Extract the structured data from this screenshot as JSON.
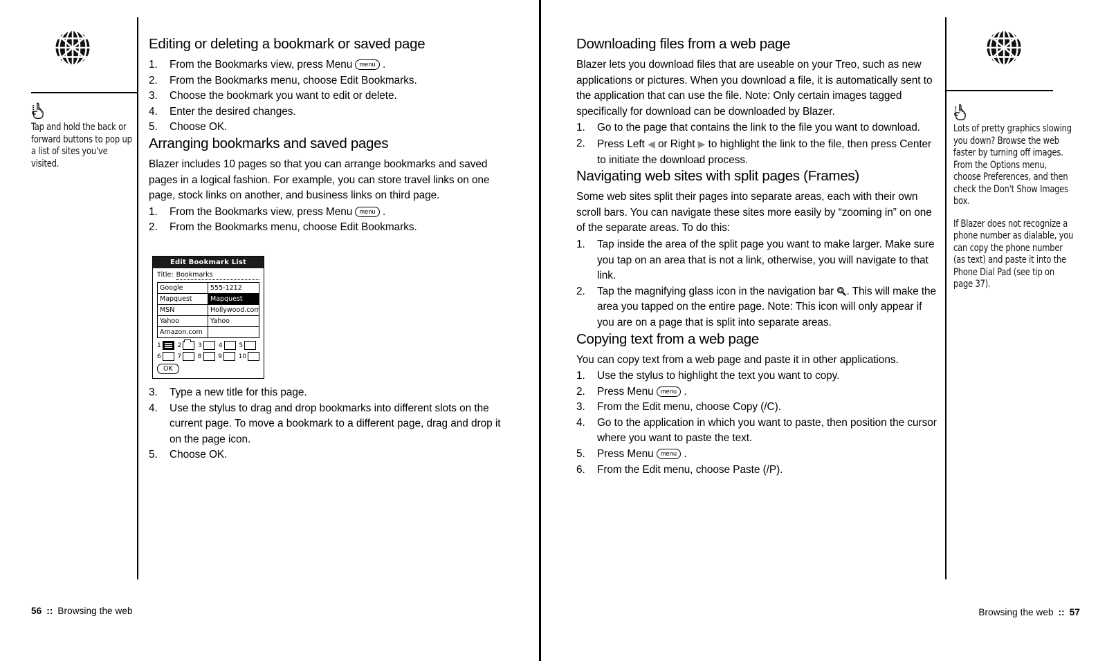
{
  "spread": {
    "icons": {
      "globe": "globe-icon",
      "tip_hand": "pointing-hand-icon",
      "menu_key": "menu",
      "left_arrow": "left-triangle-icon",
      "right_arrow": "right-triangle-icon",
      "magnifier": "magnifying-glass-icon"
    }
  },
  "left_page": {
    "margin": {
      "notes": [
        "Tap and hold the back or forward buttons to pop up a list of sites you've visited."
      ]
    },
    "sections": [
      {
        "heading": "Editing or deleting a bookmark or saved page",
        "intro": "",
        "steps": [
          {
            "num": "1.",
            "pre": "From the Bookmarks view, press Menu ",
            "key": "menu",
            "post": " ."
          },
          {
            "num": "2.",
            "pre": "From the Bookmarks menu, choose Edit Bookmarks.",
            "key": "",
            "post": ""
          },
          {
            "num": "3.",
            "pre": "Choose the bookmark you want to edit or delete.",
            "key": "",
            "post": ""
          },
          {
            "num": "4.",
            "pre": "Enter the desired changes.",
            "key": "",
            "post": ""
          },
          {
            "num": "5.",
            "pre": "Choose OK.",
            "key": "",
            "post": ""
          }
        ]
      },
      {
        "heading": "Arranging bookmarks and saved pages",
        "intro": "Blazer includes 10 pages so that you can arrange bookmarks and saved pages in a logical fashion. For example, you can store travel links on one page, stock links on another, and business links on third page.",
        "steps": [
          {
            "num": "1.",
            "pre": "From the Bookmarks view, press Menu ",
            "key": "menu",
            "post": " ."
          },
          {
            "num": "2.",
            "pre": "From the Bookmarks menu, choose Edit Bookmarks.",
            "key": "",
            "post": ""
          }
        ]
      }
    ],
    "steps_after_figure": [
      {
        "num": "3.",
        "text": "Type a new title for this page."
      },
      {
        "num": "4.",
        "text": "Use the stylus to drag and drop bookmarks into different slots on the current page. To move a bookmark to a different page, drag and drop it on the page icon."
      },
      {
        "num": "5.",
        "text": "Choose OK."
      }
    ],
    "figure": {
      "title": "Edit Bookmark List",
      "title_field_label": "Title:",
      "title_field_value": "Bookmarks",
      "rows": [
        {
          "left": "Google",
          "right": "555-1212",
          "left_selected": false,
          "right_selected": false
        },
        {
          "left": "Mapquest",
          "right": "Mapquest",
          "left_selected": false,
          "right_selected": true
        },
        {
          "left": "MSN",
          "right": "Hollywood.com",
          "left_selected": false,
          "right_selected": false
        },
        {
          "left": "Yahoo",
          "right": "Yahoo",
          "left_selected": false,
          "right_selected": false
        },
        {
          "left": "Amazon.com",
          "right": "",
          "left_selected": false,
          "right_selected": false
        }
      ],
      "page_slots_row1": [
        "1",
        "2",
        "3",
        "4",
        "5"
      ],
      "page_slots_row2": [
        "6",
        "7",
        "8",
        "9",
        "10"
      ],
      "ok_label": "OK"
    },
    "footer": {
      "page_number": "56",
      "separator": "::",
      "chapter": "Browsing the web"
    }
  },
  "right_page": {
    "margin": {
      "notes": [
        "Lots of pretty graphics slowing you down? Browse the web faster by turning off images. From the Options menu, choose Preferences, and then check the Don't Show Images box.",
        "If Blazer does not recognize a phone number as dialable, you can copy the phone number (as text) and paste it into the Phone Dial Pad (see tip on page 37)."
      ]
    },
    "sections": [
      {
        "heading": "Downloading files from a web page",
        "intro": "Blazer lets you download files that are useable on your Treo, such as new applications or pictures. When you download a file, it is automatically sent to the application that can use the file. Note: Only certain images tagged specifically for download can be downloaded by Blazer.",
        "steps": [
          {
            "num": "1.",
            "segments": [
              {
                "t": "text",
                "v": "Go to the page that contains the link to the file you want to download."
              }
            ]
          },
          {
            "num": "2.",
            "segments": [
              {
                "t": "text",
                "v": "Press Left "
              },
              {
                "t": "tri-left",
                "v": "◀"
              },
              {
                "t": "text",
                "v": " or Right "
              },
              {
                "t": "tri-right",
                "v": "▶"
              },
              {
                "t": "text",
                "v": " to highlight the link to the file, then press Center to initiate the download process."
              }
            ]
          }
        ]
      },
      {
        "heading": "Navigating web sites with split pages (Frames)",
        "intro": "Some web sites split their pages into separate areas, each with their own scroll bars. You can navigate these sites more easily by “zooming in” on one of the separate areas. To do this:",
        "steps": [
          {
            "num": "1.",
            "segments": [
              {
                "t": "text",
                "v": "Tap inside the area of the split page you want to make larger. Make sure you tap on an area that is not a link, otherwise, you will navigate to that link."
              }
            ]
          },
          {
            "num": "2.",
            "segments": [
              {
                "t": "text",
                "v": "Tap the magnifying glass icon in the navigation bar "
              },
              {
                "t": "mag",
                "v": ""
              },
              {
                "t": "text",
                "v": ". This will make the area you tapped on the entire page. Note: This icon will only appear if you are on a page that is split into separate areas."
              }
            ]
          }
        ]
      },
      {
        "heading": "Copying text from a web page",
        "intro": "You can copy text from a web page and paste it in other applications.",
        "steps": [
          {
            "num": "1.",
            "segments": [
              {
                "t": "text",
                "v": "Use the stylus to highlight the text you want to copy."
              }
            ]
          },
          {
            "num": "2.",
            "segments": [
              {
                "t": "text",
                "v": "Press Menu "
              },
              {
                "t": "key",
                "v": "menu"
              },
              {
                "t": "text",
                "v": " ."
              }
            ]
          },
          {
            "num": "3.",
            "segments": [
              {
                "t": "text",
                "v": "From the Edit menu, choose Copy (/C)."
              }
            ]
          },
          {
            "num": "4.",
            "segments": [
              {
                "t": "text",
                "v": "Go to the application in which you want to paste, then position the cursor where you want to paste the text."
              }
            ]
          },
          {
            "num": "5.",
            "segments": [
              {
                "t": "text",
                "v": "Press Menu "
              },
              {
                "t": "key",
                "v": "menu"
              },
              {
                "t": "text",
                "v": " ."
              }
            ]
          },
          {
            "num": "6.",
            "segments": [
              {
                "t": "text",
                "v": "From the Edit menu, choose Paste (/P)."
              }
            ]
          }
        ]
      }
    ],
    "footer": {
      "page_number": "57",
      "separator": "::",
      "chapter": "Browsing the web"
    }
  }
}
